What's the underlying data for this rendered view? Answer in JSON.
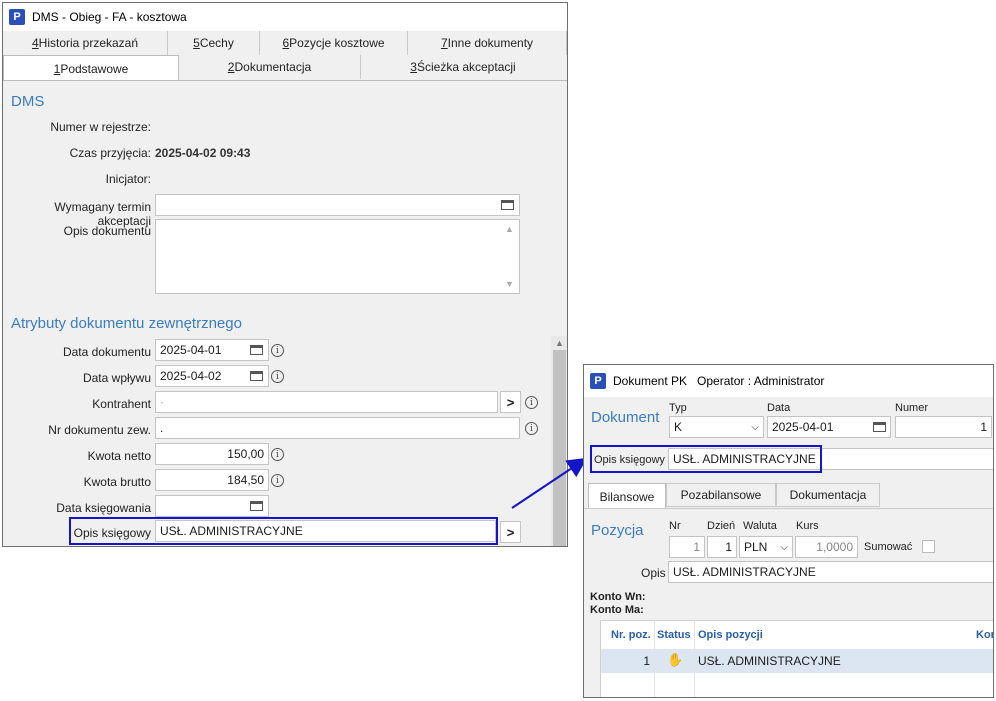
{
  "dms_window": {
    "title": "DMS - Obieg - FA - kosztowa",
    "app_icon": "P",
    "tabs_back": [
      {
        "hotkey": "4",
        "label": " Historia przekazań"
      },
      {
        "hotkey": "5",
        "label": " Cechy"
      },
      {
        "hotkey": "6",
        "label": " Pozycje kosztowe"
      },
      {
        "hotkey": "7",
        "label": " Inne dokumenty"
      }
    ],
    "tabs_front": [
      {
        "hotkey": "1",
        "label": " Podstawowe"
      },
      {
        "hotkey": "2",
        "label": " Dokumentacja"
      },
      {
        "hotkey": "3",
        "label": " Ścieżka akceptacji"
      }
    ],
    "section_dms": "DMS",
    "nr_rejestr_label": "Numer w rejestrze:",
    "czas_label": "Czas przyjęcia:",
    "czas_value": "2025-04-02 09:43",
    "inicjator_label": "Inicjator:",
    "termin_label": "Wymagany termin akceptacji",
    "opis_dok_label": "Opis dokumentu",
    "section_attr": "Atrybuty dokumentu zewnętrznego",
    "data_dok_label": "Data dokumentu",
    "data_dok_value": "2025-04-01",
    "data_wplywu_label": "Data wpływu",
    "data_wplywu_value": "2025-04-02",
    "kontrahent_label": "Kontrahent",
    "kontrahent_value": "·",
    "nr_dok_zew_label": "Nr dokumentu zew.",
    "nr_dok_zew_value": ".",
    "kwota_netto_label": "Kwota netto",
    "kwota_netto_value": "150,00",
    "kwota_brutto_label": "Kwota brutto",
    "kwota_brutto_value": "184,50",
    "data_ksieg_label": "Data księgowania",
    "opis_ksieg_label": "Opis księgowy",
    "opis_ksieg_value": "USŁ. ADMINISTRACYJNE",
    "info_glyph": "i",
    "arrow_glyph": ">"
  },
  "pk_window": {
    "title": "Dokument PK   Operator : Administrator",
    "app_icon": "P",
    "section_dok": "Dokument",
    "typ_label": "Typ",
    "typ_value": "K",
    "data_label": "Data",
    "data_value": "2025-04-01",
    "numer_label": "Numer",
    "numer_value": "1",
    "opis_ksieg_label": "Opis księgowy",
    "opis_ksieg_value": "USŁ. ADMINISTRACYJNE",
    "tabs": [
      "Bilansowe",
      "Pozabilansowe",
      "Dokumentacja"
    ],
    "section_poz": "Pozycja",
    "nr_label": "Nr",
    "nr_value": "1",
    "dzien_label": "Dzień",
    "dzien_value": "1",
    "waluta_label": "Waluta",
    "waluta_value": "PLN",
    "kurs_label": "Kurs",
    "kurs_value": "1,0000",
    "sumowac_label": "Sumować",
    "opis_label": "Opis",
    "opis_value": "USŁ. ADMINISTRACYJNE",
    "konto_wn_label": "Konto Wn:",
    "konto_ma_label": "Konto Ma:",
    "grid_headers": [
      "Nr. poz.",
      "Status",
      "Opis pozycji",
      "Kon"
    ],
    "grid_row": {
      "nr": "1",
      "opis": "USŁ. ADMINISTRACYJNE"
    }
  },
  "colors": {
    "accent": "#3a7dc0",
    "highlight": "#1414c8",
    "icon_bg": "#2b4fb8"
  }
}
